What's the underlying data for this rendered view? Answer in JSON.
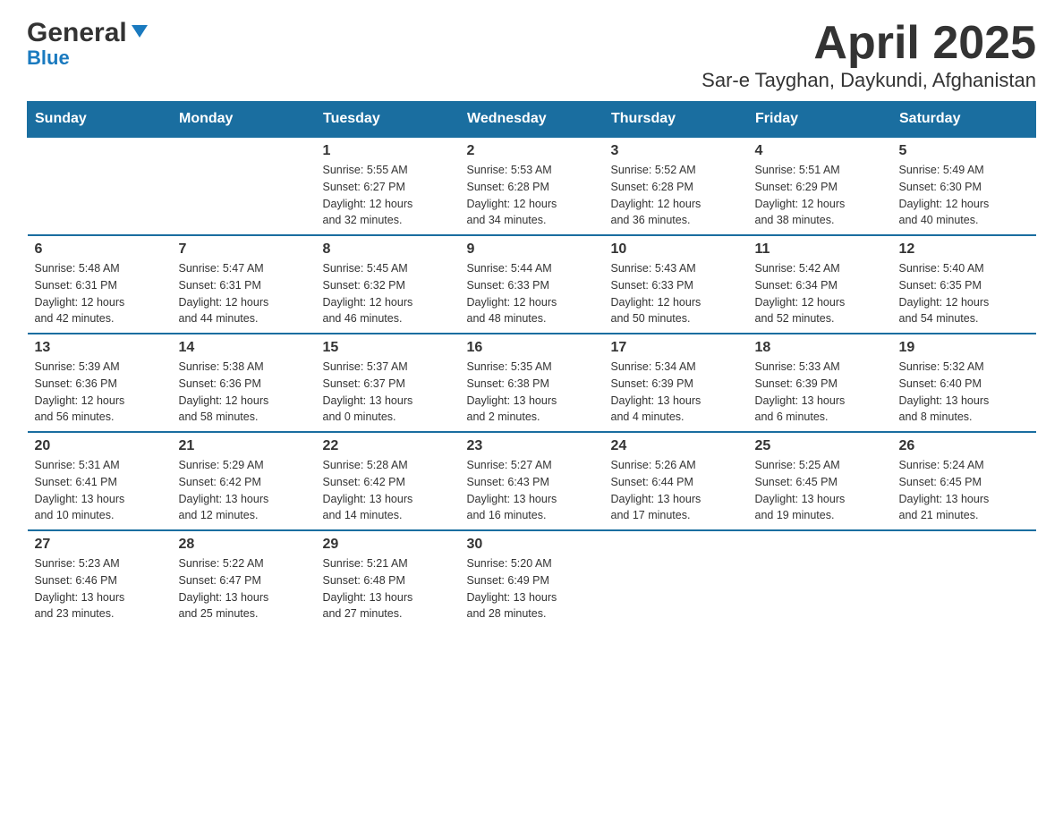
{
  "header": {
    "logo_general": "General",
    "logo_blue": "Blue",
    "title": "April 2025",
    "subtitle": "Sar-e Tayghan, Daykundi, Afghanistan"
  },
  "days_of_week": [
    "Sunday",
    "Monday",
    "Tuesday",
    "Wednesday",
    "Thursday",
    "Friday",
    "Saturday"
  ],
  "weeks": [
    [
      {
        "day": "",
        "info": ""
      },
      {
        "day": "",
        "info": ""
      },
      {
        "day": "1",
        "info": "Sunrise: 5:55 AM\nSunset: 6:27 PM\nDaylight: 12 hours\nand 32 minutes."
      },
      {
        "day": "2",
        "info": "Sunrise: 5:53 AM\nSunset: 6:28 PM\nDaylight: 12 hours\nand 34 minutes."
      },
      {
        "day": "3",
        "info": "Sunrise: 5:52 AM\nSunset: 6:28 PM\nDaylight: 12 hours\nand 36 minutes."
      },
      {
        "day": "4",
        "info": "Sunrise: 5:51 AM\nSunset: 6:29 PM\nDaylight: 12 hours\nand 38 minutes."
      },
      {
        "day": "5",
        "info": "Sunrise: 5:49 AM\nSunset: 6:30 PM\nDaylight: 12 hours\nand 40 minutes."
      }
    ],
    [
      {
        "day": "6",
        "info": "Sunrise: 5:48 AM\nSunset: 6:31 PM\nDaylight: 12 hours\nand 42 minutes."
      },
      {
        "day": "7",
        "info": "Sunrise: 5:47 AM\nSunset: 6:31 PM\nDaylight: 12 hours\nand 44 minutes."
      },
      {
        "day": "8",
        "info": "Sunrise: 5:45 AM\nSunset: 6:32 PM\nDaylight: 12 hours\nand 46 minutes."
      },
      {
        "day": "9",
        "info": "Sunrise: 5:44 AM\nSunset: 6:33 PM\nDaylight: 12 hours\nand 48 minutes."
      },
      {
        "day": "10",
        "info": "Sunrise: 5:43 AM\nSunset: 6:33 PM\nDaylight: 12 hours\nand 50 minutes."
      },
      {
        "day": "11",
        "info": "Sunrise: 5:42 AM\nSunset: 6:34 PM\nDaylight: 12 hours\nand 52 minutes."
      },
      {
        "day": "12",
        "info": "Sunrise: 5:40 AM\nSunset: 6:35 PM\nDaylight: 12 hours\nand 54 minutes."
      }
    ],
    [
      {
        "day": "13",
        "info": "Sunrise: 5:39 AM\nSunset: 6:36 PM\nDaylight: 12 hours\nand 56 minutes."
      },
      {
        "day": "14",
        "info": "Sunrise: 5:38 AM\nSunset: 6:36 PM\nDaylight: 12 hours\nand 58 minutes."
      },
      {
        "day": "15",
        "info": "Sunrise: 5:37 AM\nSunset: 6:37 PM\nDaylight: 13 hours\nand 0 minutes."
      },
      {
        "day": "16",
        "info": "Sunrise: 5:35 AM\nSunset: 6:38 PM\nDaylight: 13 hours\nand 2 minutes."
      },
      {
        "day": "17",
        "info": "Sunrise: 5:34 AM\nSunset: 6:39 PM\nDaylight: 13 hours\nand 4 minutes."
      },
      {
        "day": "18",
        "info": "Sunrise: 5:33 AM\nSunset: 6:39 PM\nDaylight: 13 hours\nand 6 minutes."
      },
      {
        "day": "19",
        "info": "Sunrise: 5:32 AM\nSunset: 6:40 PM\nDaylight: 13 hours\nand 8 minutes."
      }
    ],
    [
      {
        "day": "20",
        "info": "Sunrise: 5:31 AM\nSunset: 6:41 PM\nDaylight: 13 hours\nand 10 minutes."
      },
      {
        "day": "21",
        "info": "Sunrise: 5:29 AM\nSunset: 6:42 PM\nDaylight: 13 hours\nand 12 minutes."
      },
      {
        "day": "22",
        "info": "Sunrise: 5:28 AM\nSunset: 6:42 PM\nDaylight: 13 hours\nand 14 minutes."
      },
      {
        "day": "23",
        "info": "Sunrise: 5:27 AM\nSunset: 6:43 PM\nDaylight: 13 hours\nand 16 minutes."
      },
      {
        "day": "24",
        "info": "Sunrise: 5:26 AM\nSunset: 6:44 PM\nDaylight: 13 hours\nand 17 minutes."
      },
      {
        "day": "25",
        "info": "Sunrise: 5:25 AM\nSunset: 6:45 PM\nDaylight: 13 hours\nand 19 minutes."
      },
      {
        "day": "26",
        "info": "Sunrise: 5:24 AM\nSunset: 6:45 PM\nDaylight: 13 hours\nand 21 minutes."
      }
    ],
    [
      {
        "day": "27",
        "info": "Sunrise: 5:23 AM\nSunset: 6:46 PM\nDaylight: 13 hours\nand 23 minutes."
      },
      {
        "day": "28",
        "info": "Sunrise: 5:22 AM\nSunset: 6:47 PM\nDaylight: 13 hours\nand 25 minutes."
      },
      {
        "day": "29",
        "info": "Sunrise: 5:21 AM\nSunset: 6:48 PM\nDaylight: 13 hours\nand 27 minutes."
      },
      {
        "day": "30",
        "info": "Sunrise: 5:20 AM\nSunset: 6:49 PM\nDaylight: 13 hours\nand 28 minutes."
      },
      {
        "day": "",
        "info": ""
      },
      {
        "day": "",
        "info": ""
      },
      {
        "day": "",
        "info": ""
      }
    ]
  ]
}
